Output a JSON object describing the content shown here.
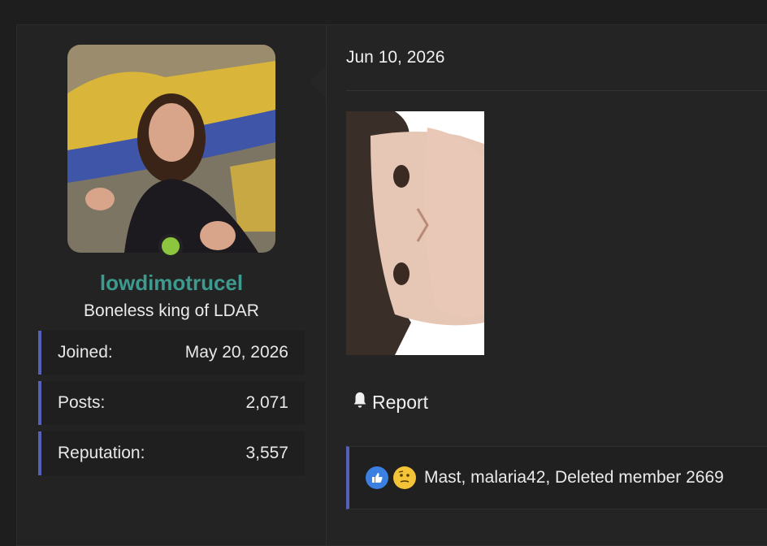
{
  "user": {
    "username": "lowdimotrucel",
    "title": "Boneless king of LDAR",
    "stats": [
      {
        "label": "Joined:",
        "value": "May 20, 2026"
      },
      {
        "label": "Posts:",
        "value": "2,071"
      },
      {
        "label": "Reputation:",
        "value": "3,557"
      }
    ],
    "online": true
  },
  "post": {
    "date": "Jun 10, 2026",
    "report_label": "Report"
  },
  "reactions": {
    "icons": [
      "like-icon",
      "thinking-icon"
    ],
    "text": "Mast, malaria42, Deleted member 2669"
  },
  "colors": {
    "username": "#3d9a8f",
    "accent_bar": "#5560b8",
    "online": "#8cc63f",
    "background": "#1e1e1e"
  }
}
